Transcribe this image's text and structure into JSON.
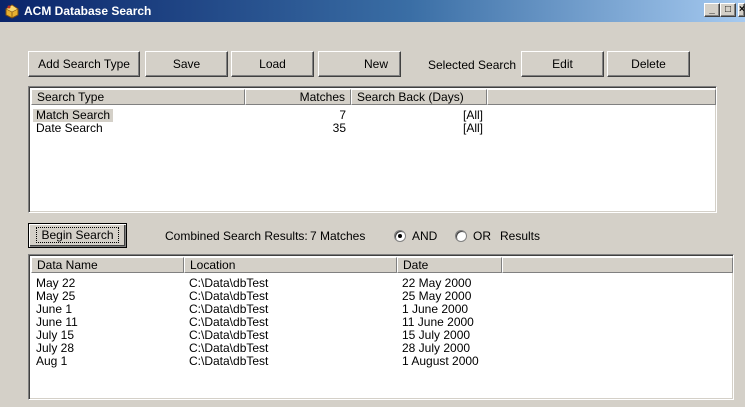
{
  "window": {
    "title": "ACM Database Search",
    "controls": {
      "minimize": "_",
      "maximize": "□",
      "close": "×"
    }
  },
  "toolbar": {
    "add_search_type": "Add Search Type",
    "save": "Save",
    "load": "Load",
    "new": "New",
    "selected_search_label": "Selected Search",
    "edit": "Edit",
    "delete": "Delete"
  },
  "search_types": {
    "columns": [
      "Search Type",
      "Matches",
      "Search Back (Days)"
    ],
    "rows": [
      {
        "type": "Match Search",
        "matches": "7",
        "days": "[All]"
      },
      {
        "type": "Date Search",
        "matches": "35",
        "days": "[All]"
      }
    ]
  },
  "search_bar": {
    "begin_search": "Begin Search",
    "combined_label": "Combined Search Results:",
    "combined_value": "7 Matches",
    "and_label": "AND",
    "or_label": "OR",
    "results_label": "Results",
    "selected_mode": "AND"
  },
  "results": {
    "columns": [
      "Data Name",
      "Location",
      "Date"
    ],
    "rows": [
      {
        "name": "May 22",
        "location": "C:\\Data\\dbTest",
        "date": "22 May 2000"
      },
      {
        "name": "May 25",
        "location": "C:\\Data\\dbTest",
        "date": "25 May 2000"
      },
      {
        "name": "June 1",
        "location": "C:\\Data\\dbTest",
        "date": "1 June 2000"
      },
      {
        "name": "June 11",
        "location": "C:\\Data\\dbTest",
        "date": "11 June 2000"
      },
      {
        "name": "July 15",
        "location": "C:\\Data\\dbTest",
        "date": "15 July 2000"
      },
      {
        "name": "July 28",
        "location": "C:\\Data\\dbTest",
        "date": "28 July 2000"
      },
      {
        "name": "Aug 1",
        "location": "C:\\Data\\dbTest",
        "date": "1 August 2000"
      }
    ]
  },
  "colors": {
    "title_active": "#0a246a",
    "title_gradient_end": "#a6caf0",
    "face": "#d4d0c8"
  },
  "icons": [
    "app-icon",
    "minimize-icon",
    "maximize-icon",
    "close-icon"
  ]
}
